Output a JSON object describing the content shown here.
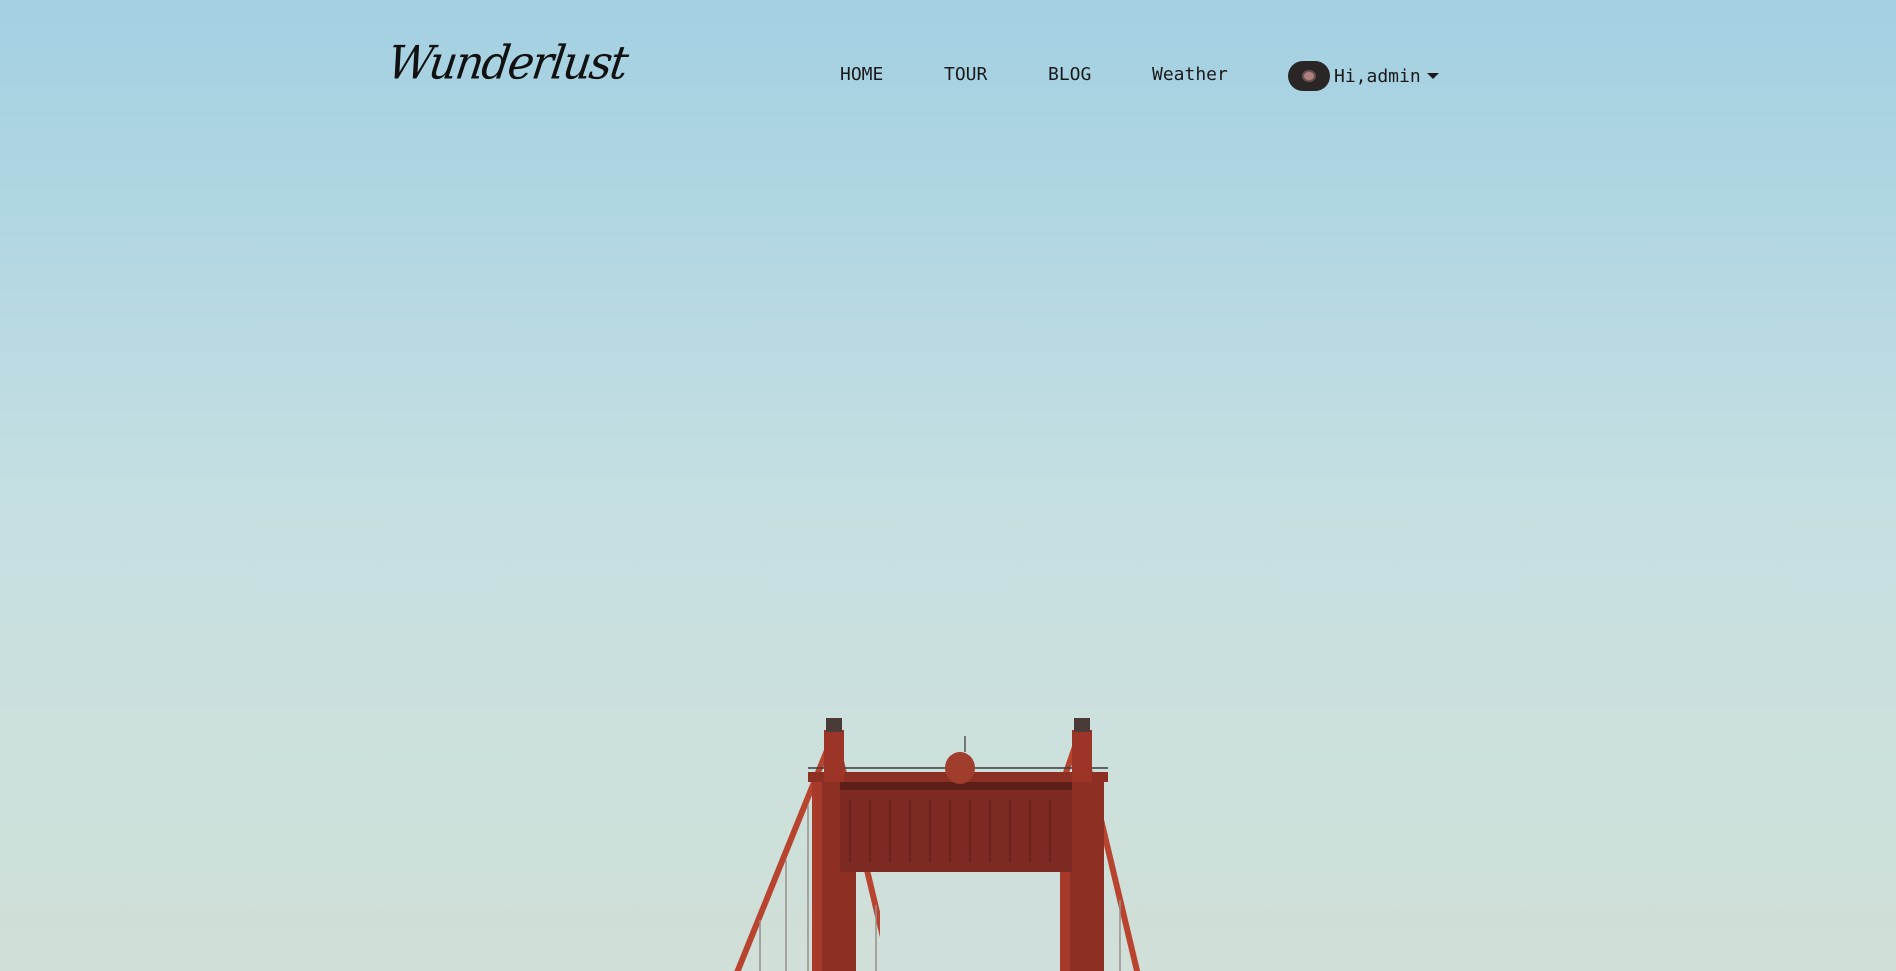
{
  "brand": {
    "logo_text": "Wunderlust"
  },
  "nav": {
    "items": [
      {
        "label": "HOME"
      },
      {
        "label": "TOUR"
      },
      {
        "label": "BLOG"
      },
      {
        "label": "Weather"
      }
    ]
  },
  "user": {
    "greeting": "Hi,admin",
    "avatar_icon": "user-avatar",
    "caret_icon": "caret-down-icon"
  },
  "hero": {
    "image": "golden-gate-bridge-tower",
    "colors": {
      "sky_top": "#a3d0e2",
      "sky_bottom": "#d0dfd7",
      "bridge": "#b8432f"
    }
  }
}
